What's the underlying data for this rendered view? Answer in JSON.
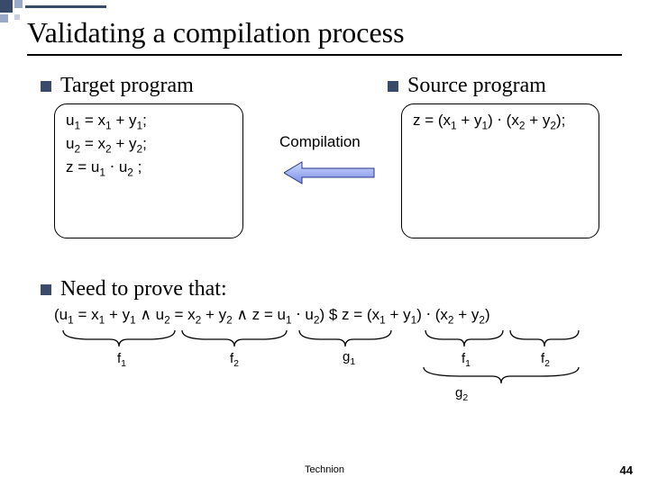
{
  "title": "Validating a compilation process",
  "target": {
    "heading": "Target program",
    "lines": [
      "u<sub>1</sub> = x<sub>1</sub> + y<sub>1</sub>;",
      "u<sub>2</sub> = x<sub>2</sub> + y<sub>2</sub>;",
      "z = u<sub>1</sub> ⋅ u<sub>2</sub> ;"
    ]
  },
  "source": {
    "heading": "Source program",
    "lines": [
      "z = (x<sub>1</sub> + y<sub>1</sub>) ⋅ (x<sub>2</sub> + y<sub>2</sub>);"
    ]
  },
  "arrow_label": "Compilation",
  "prove": {
    "heading": "Need to prove that:",
    "formula_html": "(u<sub>1</sub> = x<sub>1</sub> + y<sub>1</sub> ∧ u<sub>2</sub> = x<sub>2</sub> + y<sub>2</sub>  ∧  z = u<sub>1</sub> ⋅ u<sub>2</sub>)  $   z = (x<sub>1</sub> + y<sub>1</sub>) ⋅ (x<sub>2</sub> + y<sub>2</sub>)",
    "labels": {
      "f1": "f<sub>1</sub>",
      "f2": "f<sub>2</sub>",
      "g1": "g<sub>1</sub>",
      "f1b": "f<sub>1</sub>",
      "f2b": "f<sub>2</sub>",
      "g2": "g<sub>2</sub>"
    }
  },
  "footer": {
    "center": "Technion",
    "page": "44"
  }
}
